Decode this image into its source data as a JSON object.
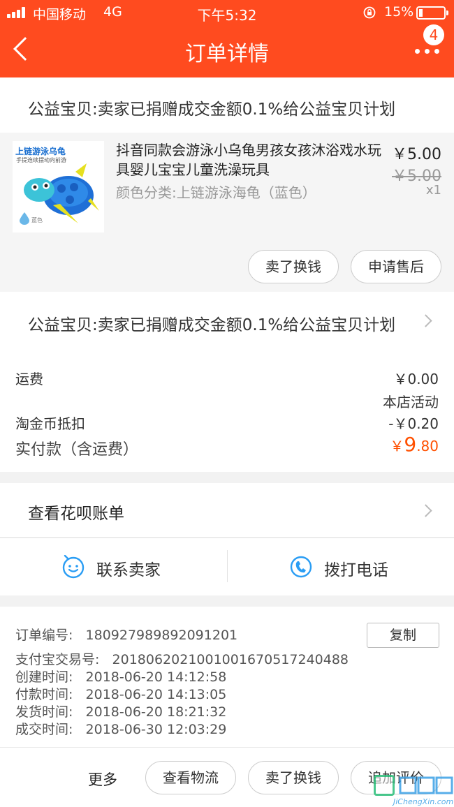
{
  "status_bar": {
    "carrier": "中国移动",
    "network": "4G",
    "time": "下午5:32",
    "battery": "15%"
  },
  "header": {
    "title": "订单详情",
    "badge_count": "4"
  },
  "charity_notice": "公益宝贝:卖家已捐赠成交金额0.1%给公益宝贝计划",
  "product": {
    "image_text": "上链游泳乌龟",
    "image_subtext": "手提连续摆动向前游",
    "image_color_label": "蓝色",
    "name": "抖音同款会游泳小乌龟男孩女孩沐浴戏水玩具婴儿宝宝儿童洗澡玩具",
    "price": "￥5.00",
    "original_price": "￥5.00",
    "quantity": "x1",
    "spec": "颜色分类:上链游泳海龟（蓝色）",
    "actions": [
      "卖了换钱",
      "申请售后"
    ]
  },
  "costs": {
    "shipping_label": "运费",
    "shipping_value": "￥0.00",
    "promo_label": "本店活动",
    "coin_label": "淘金币抵扣",
    "coin_value": "-￥0.20",
    "paid_label": "实付款（含运费）",
    "paid_currency": "￥",
    "paid_int": "9",
    "paid_dec": ".80",
    "paid_color": "#ff5000"
  },
  "huabei": "查看花呗账单",
  "contact": {
    "seller": "联系卖家",
    "phone": "拨打电话"
  },
  "order_info": {
    "order_no_label": "订单编号:",
    "order_no": "180927989892091201",
    "copy_label": "复制",
    "alipay_label": "支付宝交易号:",
    "alipay_no": "2018062021001001670517240488",
    "created_label": "创建时间:",
    "created": "2018-06-20 14:12:58",
    "paid_label": "付款时间:",
    "paid": "2018-06-20 14:13:05",
    "shipped_label": "发货时间:",
    "shipped": "2018-06-20 18:21:32",
    "completed_label": "成交时间:",
    "completed": "2018-06-30 12:03:29"
  },
  "footer": {
    "more": "更多",
    "buttons": [
      "查看物流",
      "卖了换钱",
      "追加评价"
    ]
  },
  "watermark": {
    "text": "JiChengXin.com"
  },
  "colors": {
    "brand": "#ff4b1f",
    "accent_blue": "#2a9df4"
  }
}
